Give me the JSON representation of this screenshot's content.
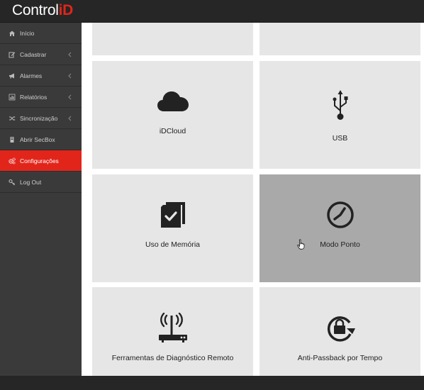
{
  "brand": {
    "name": "Control",
    "accent": "iD",
    "accent_color": "#e1251b"
  },
  "sidebar": {
    "items": [
      {
        "label": "Início",
        "icon": "home-icon",
        "has_submenu": false,
        "active": false
      },
      {
        "label": "Cadastrar",
        "icon": "edit-icon",
        "has_submenu": true,
        "active": false
      },
      {
        "label": "Alarmes",
        "icon": "megaphone-icon",
        "has_submenu": true,
        "active": false
      },
      {
        "label": "Relatórios",
        "icon": "bar-chart-icon",
        "has_submenu": true,
        "active": false
      },
      {
        "label": "Sincronização",
        "icon": "shuffle-icon",
        "has_submenu": true,
        "active": false
      },
      {
        "label": "Abrir SecBox",
        "icon": "box-icon",
        "has_submenu": false,
        "active": false
      },
      {
        "label": "Configurações",
        "icon": "gears-icon",
        "has_submenu": false,
        "active": true
      },
      {
        "label": "Log Out",
        "icon": "key-icon",
        "has_submenu": false,
        "active": false
      }
    ]
  },
  "tiles": [
    {
      "label": "iDCloud",
      "icon": "cloud-icon"
    },
    {
      "label": "USB",
      "icon": "usb-icon"
    },
    {
      "label": "Uso de Memória",
      "icon": "memory-card-icon"
    },
    {
      "label": "Modo Ponto",
      "icon": "clock-icon",
      "hover": true
    },
    {
      "label": "Ferramentas de Diagnóstico Remoto",
      "icon": "router-icon"
    },
    {
      "label": "Anti-Passback por Tempo",
      "icon": "rotate-lock-icon"
    }
  ]
}
